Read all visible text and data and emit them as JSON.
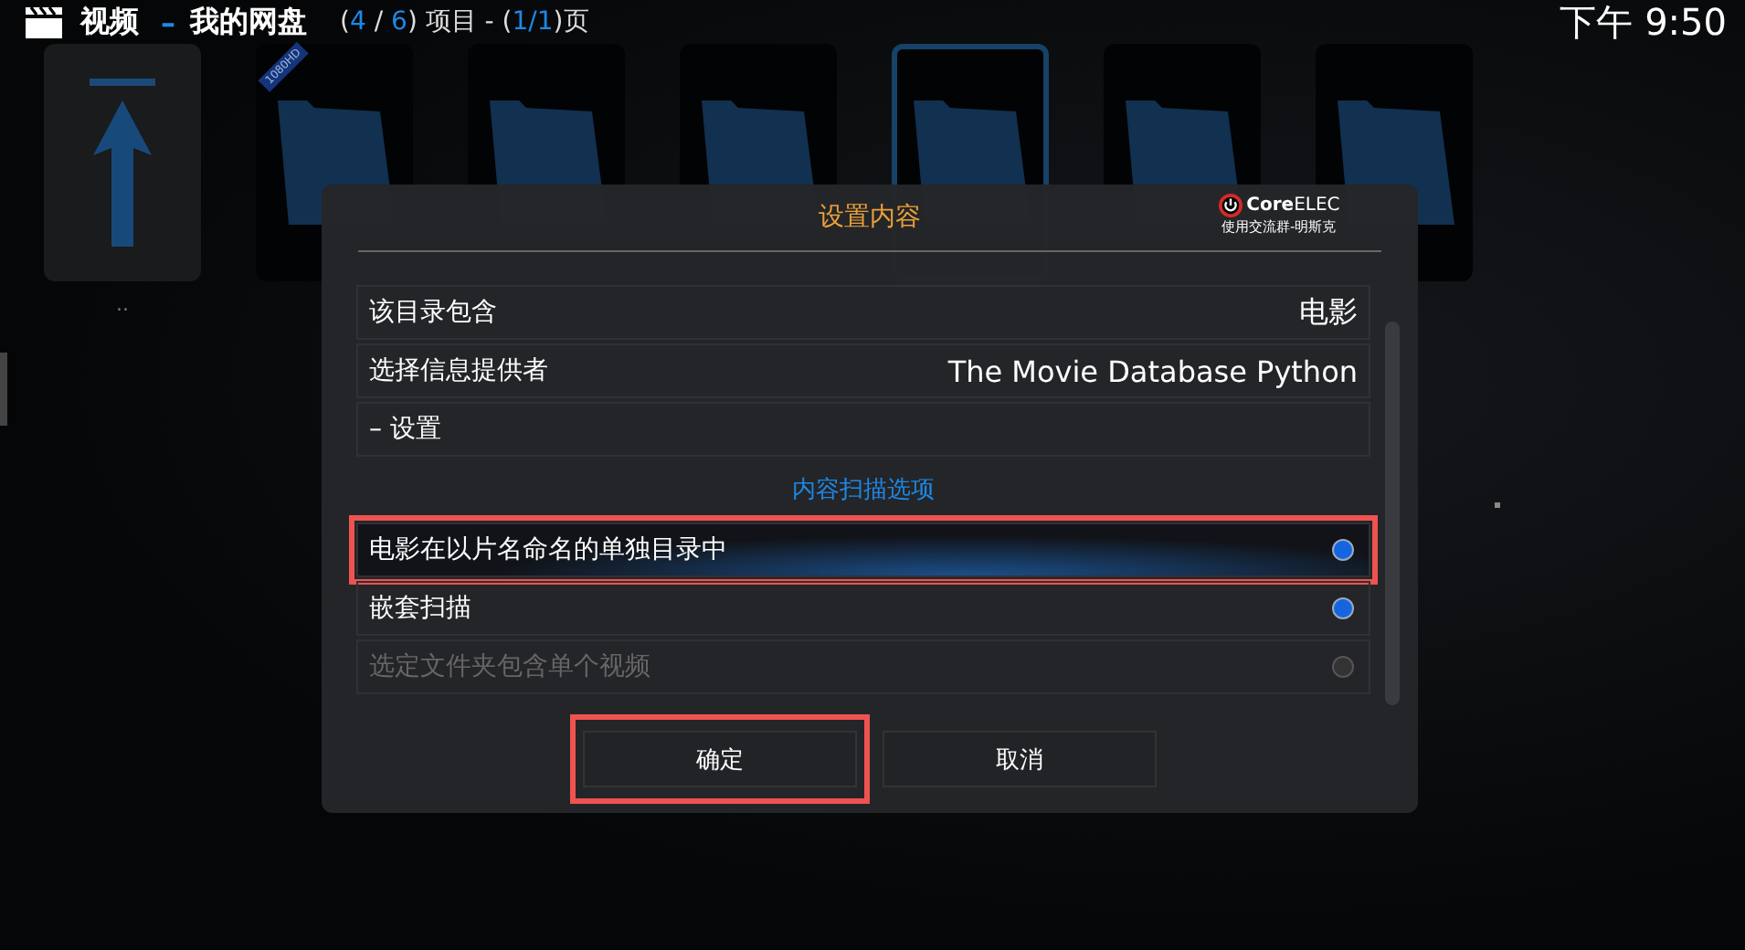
{
  "header": {
    "section": "视频",
    "separator": "–",
    "location": "我的网盘",
    "count_open": "(",
    "count_current": "4",
    "count_slash": "/",
    "count_total": "6",
    "count_close": ")",
    "count_label": "项目 -",
    "page_open": "(",
    "page_value": "1/1",
    "page_close": ")页",
    "clock": "下午 9:50"
  },
  "tiles": [
    {
      "kind": "up",
      "label": "..",
      "selected": false
    },
    {
      "kind": "folder",
      "badge": "1080HD",
      "selected": false
    },
    {
      "kind": "folder",
      "selected": false
    },
    {
      "kind": "folder",
      "selected": false
    },
    {
      "kind": "folder",
      "selected": true
    },
    {
      "kind": "folder",
      "selected": false
    },
    {
      "kind": "folder",
      "selected": false
    }
  ],
  "dialog": {
    "title": "设置内容",
    "logo_name_bold": "Core",
    "logo_name_light": "ELEC",
    "logo_caption": "使用交流群-明斯克",
    "rows": [
      {
        "kind": "value",
        "label": "该目录包含",
        "value": "电影"
      },
      {
        "kind": "value",
        "label": "选择信息提供者",
        "value": "The Movie Database Python"
      },
      {
        "kind": "plain",
        "label": "– 设置"
      },
      {
        "kind": "heading",
        "label": "内容扫描选项"
      },
      {
        "kind": "toggle",
        "label": "电影在以片名命名的单独目录中",
        "on": true,
        "disabled": false,
        "focused": true,
        "annotated": true
      },
      {
        "kind": "toggle",
        "label": "嵌套扫描",
        "on": true,
        "disabled": false,
        "focused": false,
        "annotated": false
      },
      {
        "kind": "toggle",
        "label": "选定文件夹包含单个视频",
        "on": false,
        "disabled": true,
        "focused": false,
        "annotated": false
      }
    ],
    "buttons": [
      {
        "label": "确定",
        "annotated": true
      },
      {
        "label": "取消",
        "annotated": false
      }
    ]
  }
}
